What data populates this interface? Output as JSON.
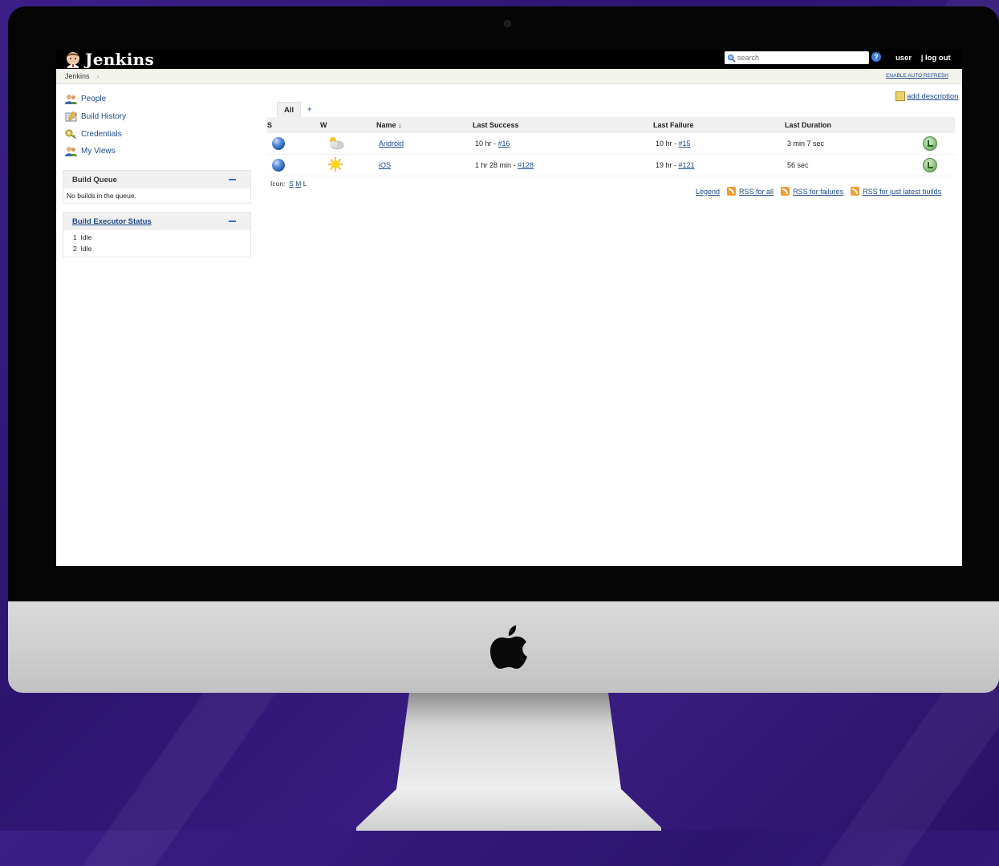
{
  "header": {
    "brand": "Jenkins",
    "search_placeholder": "search",
    "help": "?",
    "user": "user",
    "logout": "| log out"
  },
  "breadcrumb": {
    "root": "Jenkins",
    "arrow": "›",
    "auto_refresh": "ENABLE AUTO REFRESH"
  },
  "sidebar": {
    "items": [
      {
        "label": "People",
        "icon": "people-icon"
      },
      {
        "label": "Build History",
        "icon": "notepad-icon"
      },
      {
        "label": "Credentials",
        "icon": "key-icon"
      },
      {
        "label": "My Views",
        "icon": "people-icon"
      }
    ],
    "build_queue": {
      "title": "Build Queue",
      "empty": "No builds in the queue."
    },
    "executor_status": {
      "title": "Build Executor Status",
      "executors": [
        {
          "num": "1",
          "state": "Idle"
        },
        {
          "num": "2",
          "state": "Idle"
        }
      ]
    }
  },
  "main": {
    "add_description": "add description",
    "tabs": [
      {
        "label": "All"
      },
      {
        "label": "+"
      }
    ],
    "columns": [
      "S",
      "W",
      "Name ↓",
      "Last Success",
      "Last Failure",
      "Last Duration"
    ],
    "jobs": [
      {
        "name": "Android",
        "success_prefix": "10 hr - ",
        "success_build": "#16",
        "failure_prefix": "10 hr - ",
        "failure_build": "#15",
        "duration": "3 min 7 sec",
        "weather": "cloudy-icon"
      },
      {
        "name": "iOS",
        "success_prefix": "1 hr 28 min - ",
        "success_build": "#128",
        "failure_prefix": "19 hr - ",
        "failure_build": "#121",
        "duration": "56 sec",
        "weather": "sun-icon"
      }
    ],
    "icon_size": {
      "label": "Icon:",
      "s": "S",
      "m": "M",
      "l": "L"
    },
    "footer_links": {
      "legend": "Legend",
      "rss_all": "RSS for all",
      "rss_failures": "RSS for failures",
      "rss_latest": "RSS for just latest builds"
    }
  },
  "colors": {
    "link": "#204a87",
    "topbar": "#000000",
    "status_blue": "#1f4fa8",
    "rss": "#f39a30"
  }
}
